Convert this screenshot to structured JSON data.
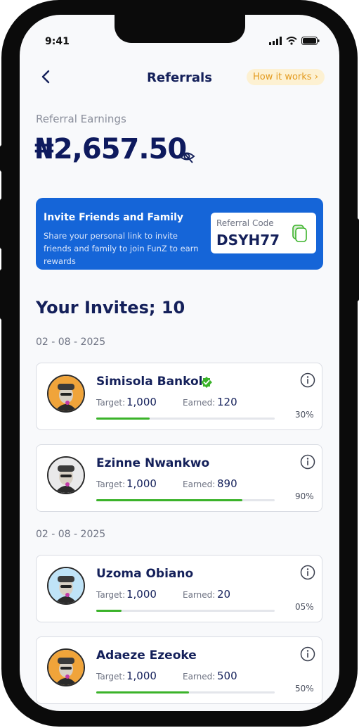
{
  "status_bar": {
    "time": "9:41"
  },
  "header": {
    "title": "Referrals",
    "how_it_works": "How it works ›"
  },
  "earnings": {
    "label": "Referral Earnings",
    "amount": "₦2,657.50"
  },
  "banner": {
    "title": "Invite Friends and Family",
    "description": "Share your personal link to invite friends and family to join FunZ to earn rewards",
    "code_label": "Referral Code",
    "code": "DSYH77"
  },
  "invites": {
    "heading": "Your Invites; 10",
    "groups": [
      {
        "date": "02 - 08 - 2025",
        "items": [
          {
            "name": "Simisola Bankole",
            "verified": true,
            "target_label": "Target:",
            "target": "1,000",
            "earned_label": "Earned:",
            "earned": "120",
            "percent": "30%",
            "progress": 0.3,
            "avatar_bg": "#f0a43a"
          },
          {
            "name": "Ezinne Nwankwo",
            "verified": false,
            "target_label": "Target:",
            "target": "1,000",
            "earned_label": "Earned:",
            "earned": "890",
            "percent": "90%",
            "progress": 0.82,
            "avatar_bg": "#e9e9ea"
          }
        ]
      },
      {
        "date": "02 - 08 - 2025",
        "items": [
          {
            "name": "Uzoma Obiano",
            "verified": false,
            "target_label": "Target:",
            "target": "1,000",
            "earned_label": "Earned:",
            "earned": "20",
            "percent": "05%",
            "progress": 0.14,
            "avatar_bg": "#bfe3f7"
          },
          {
            "name": "Adaeze Ezeoke",
            "verified": false,
            "target_label": "Target:",
            "target": "1,000",
            "earned_label": "Earned:",
            "earned": "500",
            "percent": "50%",
            "progress": 0.52,
            "avatar_bg": "#f0a43a"
          }
        ]
      }
    ]
  },
  "colors": {
    "primary": "#1565d8",
    "navy": "#14205a",
    "progress": "#3bb32a",
    "accent": "#e39a1d"
  }
}
